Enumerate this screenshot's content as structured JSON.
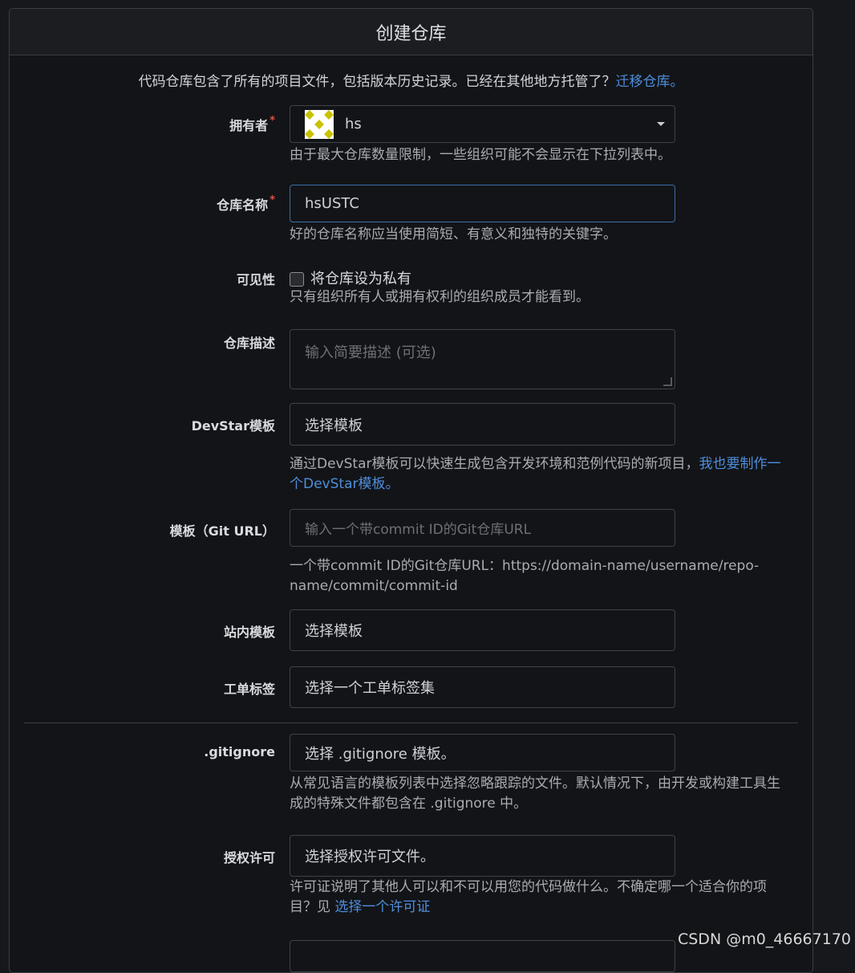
{
  "header": {
    "title": "创建仓库"
  },
  "intro": {
    "text": "代码仓库包含了所有的项目文件，包括版本历史记录。已经在其他地方托管了？",
    "link": "迁移仓库。"
  },
  "owner": {
    "label": "拥有者",
    "required": "*",
    "value": "hs",
    "help": "由于最大仓库数量限制，一些组织可能不会显示在下拉列表中。"
  },
  "repo_name": {
    "label": "仓库名称",
    "required": "*",
    "value": "hsUSTC",
    "help": "好的仓库名称应当使用简短、有意义和独特的关键字。"
  },
  "visibility": {
    "label": "可见性",
    "checkbox_label": "将仓库设为私有",
    "help": "只有组织所有人或拥有权利的组织成员才能看到。"
  },
  "description": {
    "label": "仓库描述",
    "placeholder": "输入简要描述 (可选)"
  },
  "devstar": {
    "label": "DevStar模板",
    "placeholder": "选择模板",
    "help_text": "通过DevStar模板可以快速生成包含开发环境和范例代码的新项目，",
    "help_link": "我也要制作一",
    "help_link2": "个DevStar模板。"
  },
  "git_template": {
    "label": "模板（Git URL）",
    "placeholder": "输入一个带commit ID的Git仓库URL",
    "help1": "一个带commit ID的Git仓库URL：https://domain-name/username/repo-",
    "help2": "name/commit/commit-id"
  },
  "site_template": {
    "label": "站内模板",
    "placeholder": "选择模板"
  },
  "issue_labels": {
    "label": "工单标签",
    "placeholder": "选择一个工单标签集"
  },
  "gitignore": {
    "label": ".gitignore",
    "placeholder": "选择 .gitignore 模板。",
    "help1": "从常见语言的模板列表中选择忽略跟踪的文件。默认情况下，由开发或构建工具生",
    "help2": "成的特殊文件都包含在 .gitignore 中。"
  },
  "license": {
    "label": "授权许可",
    "placeholder": "选择授权许可文件。",
    "help1": "许可证说明了其他人可以和不可以用您的代码做什么。不确定哪一个适合你的项",
    "help2": "目？见 ",
    "help_link": "选择一个许可证"
  },
  "watermark": "CSDN @m0_46667170"
}
